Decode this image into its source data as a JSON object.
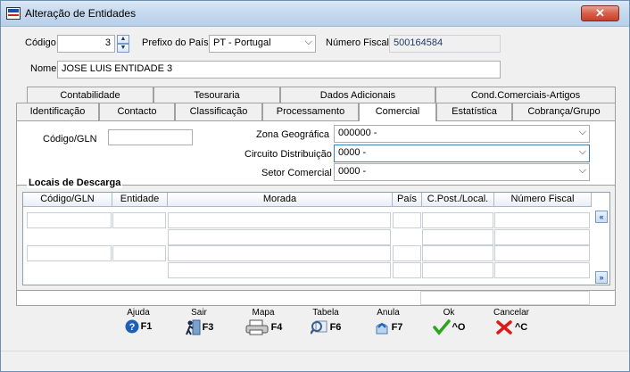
{
  "window": {
    "title": "Alteração de Entidades",
    "close_label": "✕"
  },
  "header": {
    "codigo_label": "Código",
    "codigo_value": "3",
    "prefixo_label": "Prefixo do País",
    "prefixo_value": "PT - Portugal",
    "nif_label": "Número Fiscal",
    "nif_value": "500164584",
    "nome_label": "Nome",
    "nome_value": "JOSE LUIS ENTIDADE 3"
  },
  "tabs_top": [
    "Contabilidade",
    "Tesouraria",
    "Dados Adicionais",
    "Cond.Comerciais-Artigos"
  ],
  "tabs_bottom": [
    "Identificação",
    "Contacto",
    "Classificação",
    "Processamento",
    "Comercial",
    "Estatística",
    "Cobrança/Grupo"
  ],
  "active_tab": "Comercial",
  "comercial": {
    "gln_label": "Código/GLN",
    "gln_value": "",
    "zona_label": "Zona Geográfica",
    "zona_value": "000000 -",
    "circuito_label": "Circuito Distribuição",
    "circuito_value": "0000 -",
    "setor_label": "Setor Comercial",
    "setor_value": "0000 -"
  },
  "descarga": {
    "title": "Locais de Descarga",
    "columns": [
      "Código/GLN",
      "Entidade",
      "Morada",
      "País",
      "C.Post./Local.",
      "Número Fiscal"
    ]
  },
  "buttons": [
    {
      "label": "Ajuda",
      "key": "F1",
      "icon": "help-icon"
    },
    {
      "label": "Sair",
      "key": "F3",
      "icon": "exit-icon"
    },
    {
      "label": "Mapa",
      "key": "F4",
      "icon": "printer-icon"
    },
    {
      "label": "Tabela",
      "key": "F6",
      "icon": "search-table-icon"
    },
    {
      "label": "Anula",
      "key": "F7",
      "icon": "undo-icon"
    },
    {
      "label": "Ok",
      "key": "^O",
      "icon": "check-icon"
    },
    {
      "label": "Cancelar",
      "key": "^C",
      "icon": "cross-icon"
    }
  ],
  "colors": {
    "ok": "#2aa51c",
    "cancel": "#d81b1b",
    "help": "#1d5fb8"
  }
}
